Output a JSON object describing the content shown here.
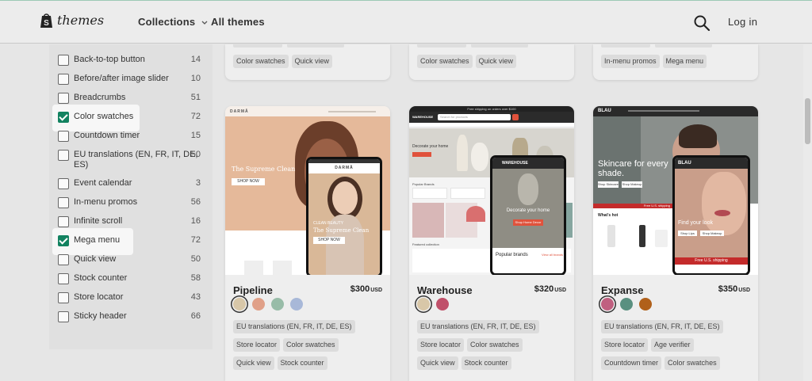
{
  "header": {
    "logo_text": "themes",
    "nav": {
      "collections": "Collections",
      "all_themes": "All themes"
    },
    "login": "Log in"
  },
  "colors": {
    "accent": "#128260",
    "header_bg": "#ececec",
    "page_bg": "#e6e6e6"
  },
  "filters": [
    {
      "label": "Back-to-top button",
      "count": "14",
      "checked": false
    },
    {
      "label": "Before/after image slider",
      "count": "10",
      "checked": false
    },
    {
      "label": "Breadcrumbs",
      "count": "51",
      "checked": false
    },
    {
      "label": "Color swatches",
      "count": "72",
      "checked": true
    },
    {
      "label": "Countdown timer",
      "count": "15",
      "checked": false
    },
    {
      "label": "EU translations (EN, FR, IT, DE, ES)",
      "count": "50",
      "checked": false
    },
    {
      "label": "Event calendar",
      "count": "3",
      "checked": false
    },
    {
      "label": "In-menu promos",
      "count": "56",
      "checked": false
    },
    {
      "label": "Infinite scroll",
      "count": "16",
      "checked": false
    },
    {
      "label": "Mega menu",
      "count": "72",
      "checked": true
    },
    {
      "label": "Quick view",
      "count": "50",
      "checked": false
    },
    {
      "label": "Stock counter",
      "count": "58",
      "checked": false
    },
    {
      "label": "Store locator",
      "count": "43",
      "checked": false
    },
    {
      "label": "Sticky header",
      "count": "66",
      "checked": false
    }
  ],
  "top_cards": [
    {
      "tags": [
        "Color swatches",
        "Quick view"
      ]
    },
    {
      "tags": [
        "Color swatches",
        "Quick view"
      ]
    },
    {
      "tags": [
        "In-menu promos",
        "Mega menu"
      ]
    }
  ],
  "cards": [
    {
      "name": "Pipeline",
      "price": "$300",
      "currency": "USD",
      "swatches": [
        "#d8c7a8",
        "#e0a088",
        "#98bca8",
        "#a8b8d8"
      ],
      "tag_rows": [
        [
          "EU translations (EN, FR, IT, DE, ES)"
        ],
        [
          "Store locator",
          "Color swatches"
        ],
        [
          "Quick view",
          "Stock counter"
        ]
      ],
      "preview": {
        "brand": "DARMĀ",
        "headline": "The Supreme Clean",
        "cta": "SHOP NOW",
        "mobile_headline": "The Supreme Clean",
        "mobile_kicker": "CLEAN BEAUTY",
        "mobile_cta": "SHOP NOW"
      }
    },
    {
      "name": "Warehouse",
      "price": "$320",
      "currency": "USD",
      "swatches": [
        "#d8c7a8",
        "#c0506a"
      ],
      "tag_rows": [
        [
          "EU translations (EN, FR, IT, DE, ES)"
        ],
        [
          "Store locator",
          "Color swatches"
        ],
        [
          "Quick view",
          "Stock counter"
        ]
      ],
      "preview": {
        "brand": "WAREHOUSE",
        "banner": "Free shipping on orders over $100",
        "headline": "Decorate your home",
        "mobile_headline": "Decorate your home",
        "mobile_cta": "Shop Home Decor",
        "popular_brands": "Popular brands",
        "view_all": "View all brands",
        "section_popular": "Popular Brands",
        "section_featured": "Featured collection",
        "search_placeholder": "Search for products",
        "categories_label": "All categories"
      }
    },
    {
      "name": "Expanse",
      "price": "$350",
      "currency": "USD",
      "swatches": [
        "#c06080",
        "#5a9080",
        "#b0601a"
      ],
      "tag_rows": [
        [
          "EU translations (EN, FR, IT, DE, ES)"
        ],
        [
          "Store locator",
          "Age verifier"
        ],
        [
          "Countdown timer",
          "Color swatches"
        ]
      ],
      "preview": {
        "brand": "BLAU",
        "headline": "Skincare for every shade.",
        "btn1": "Shop Skincare",
        "btn2": "Shop Makeup",
        "whats_hot": "What's hot",
        "mobile_headline": "Find your look",
        "mobile_btn1": "Shop Lips",
        "mobile_btn2": "Shop Makeup",
        "mobile_shipping": "Free U.S. shipping",
        "shipping_strip": "Free U.S. shipping"
      }
    }
  ]
}
